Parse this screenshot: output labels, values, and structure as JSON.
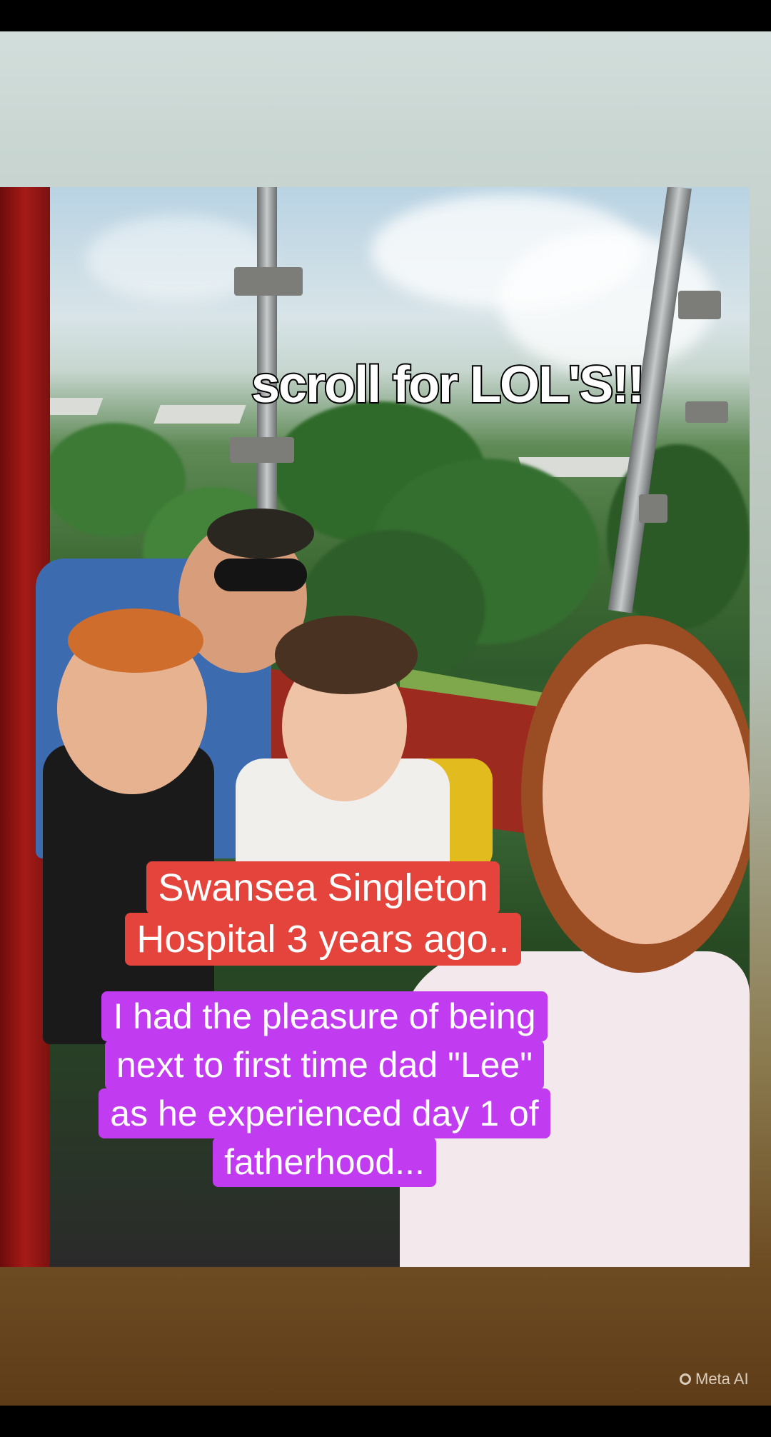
{
  "overlay": {
    "top_caption": "scroll for LOL'S!!",
    "red_sticker_lines": [
      "Swansea Singleton",
      "Hospital 3 years ago.."
    ],
    "purple_sticker_lines": [
      "I had the pleasure of being",
      "next to first time dad \"Lee\"",
      "as he experienced day 1 of",
      "fatherhood..."
    ]
  },
  "badge": {
    "label": "Meta AI",
    "icon": "meta-ai-ring-icon"
  },
  "colors": {
    "red_sticker": "#e4443c",
    "purple_sticker": "#c13cf0",
    "caption_text": "#ffffff"
  }
}
